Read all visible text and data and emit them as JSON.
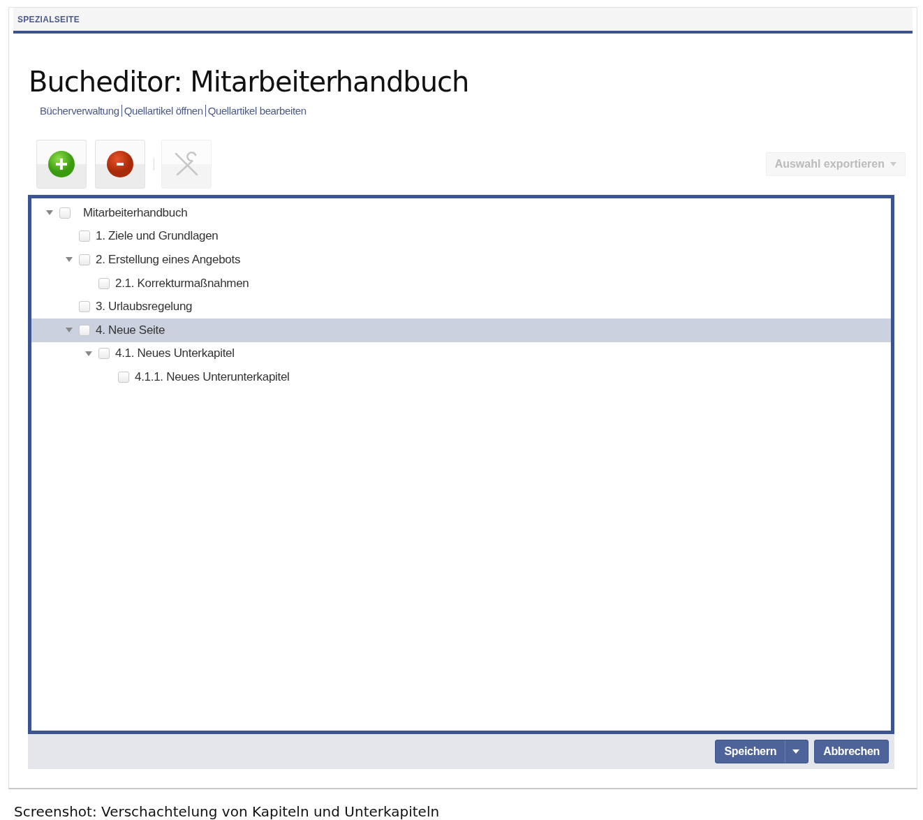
{
  "header": {
    "label": "SPEZIALSEITE"
  },
  "title": "Bucheditor: Mitarbeiterhandbuch",
  "links": [
    "Bücherverwaltung",
    "Quellartikel öffnen",
    "Quellartikel bearbeiten"
  ],
  "toolbar": {
    "buttons": [
      {
        "kind": "add",
        "disabled": false
      },
      {
        "kind": "remove",
        "disabled": false
      },
      {
        "kind": "tools",
        "disabled": true
      }
    ],
    "export_button": {
      "label": "Auswahl exportieren",
      "disabled": true
    }
  },
  "tree": [
    {
      "label": "Mitarbeiterhandbuch",
      "checked": false,
      "selected": false,
      "expanded": true,
      "children": [
        {
          "label": "1. Ziele und Grundlagen",
          "checked": false,
          "selected": false
        },
        {
          "label": "2. Erstellung eines Angebots",
          "checked": false,
          "selected": false,
          "expanded": true,
          "children": [
            {
              "label": "2.1. Korrekturmaßnahmen",
              "checked": false,
              "selected": false
            }
          ]
        },
        {
          "label": "3. Urlaubsregelung",
          "checked": false,
          "selected": false
        },
        {
          "label": "4. Neue Seite",
          "checked": false,
          "selected": true,
          "expanded": true,
          "children": [
            {
              "label": "4.1. Neues Unterkapitel",
              "checked": false,
              "selected": false,
              "expanded": true,
              "children": [
                {
                  "label": "4.1.1. Neues Unterunterkapitel",
                  "checked": false,
                  "selected": false
                }
              ]
            }
          ]
        }
      ]
    }
  ],
  "footer_buttons": [
    {
      "label": "Speichern",
      "kind": "split"
    },
    {
      "label": "Abbrechen",
      "kind": "plain"
    }
  ],
  "caption": "Screenshot: Verschachtelung von Kapiteln und Unterkapiteln"
}
